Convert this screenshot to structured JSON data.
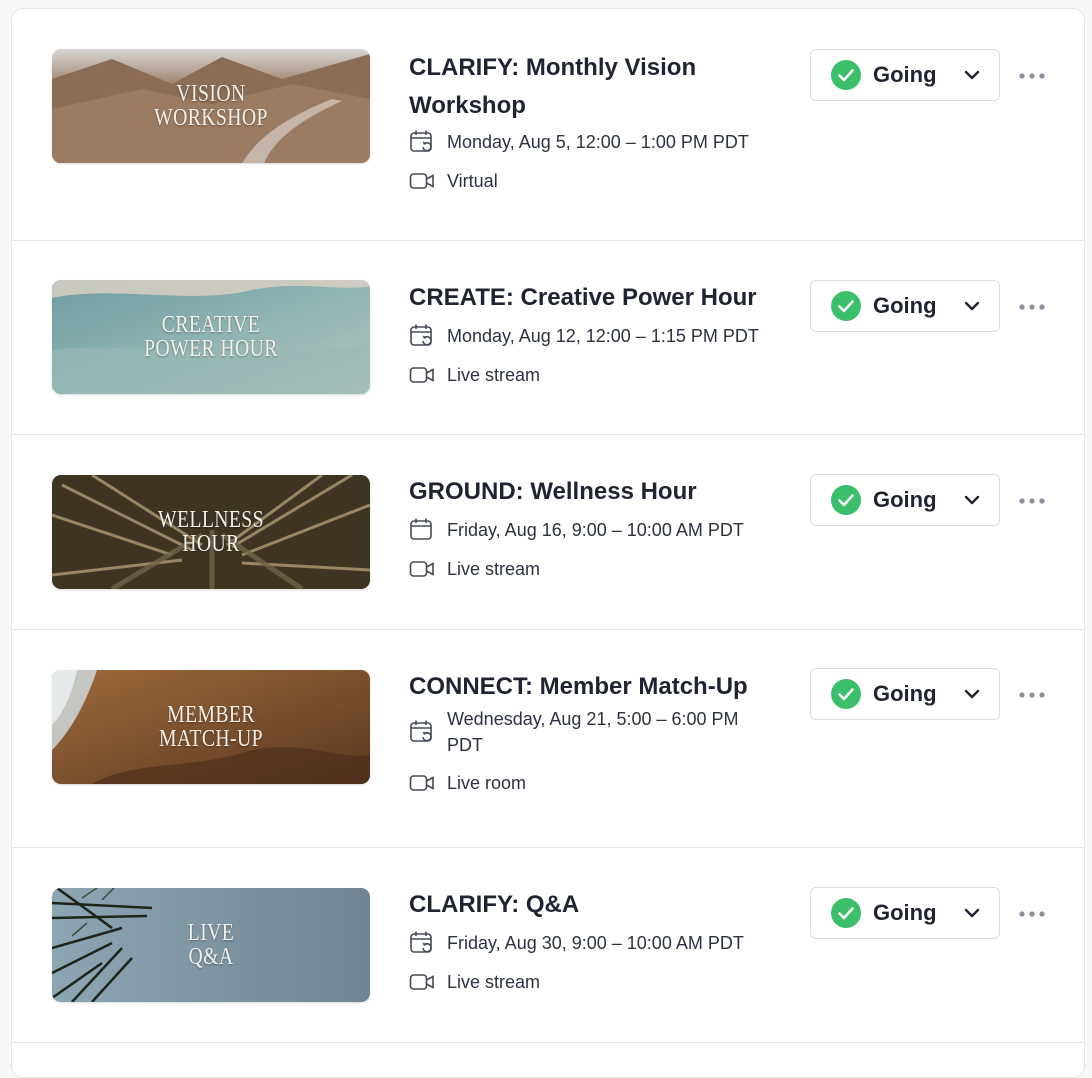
{
  "events": [
    {
      "title": "CLARIFY: Monthly Vision Workshop",
      "thumb_text": "VISION\nWORKSHOP",
      "thumb_theme": "desert",
      "date": "Monday, Aug 5, 12:00 – 1:00 PM PDT",
      "date_icon": "calendar-repeat-icon",
      "location": "Virtual",
      "rsvp": "Going"
    },
    {
      "title": "CREATE: Creative Power Hour",
      "thumb_text": "CREATIVE\nPOWER HOUR",
      "thumb_theme": "water",
      "date": "Monday, Aug 12, 12:00 – 1:15 PM PDT",
      "date_icon": "calendar-repeat-icon",
      "location": "Live stream",
      "rsvp": "Going"
    },
    {
      "title": "GROUND: Wellness Hour",
      "thumb_text": "WELLNESS\nHOUR",
      "thumb_theme": "palm",
      "date": "Friday, Aug 16, 9:00 – 10:00 AM PDT",
      "date_icon": "calendar-icon",
      "location": "Live stream",
      "rsvp": "Going"
    },
    {
      "title": "CONNECT: Member Match-Up",
      "thumb_text": "MEMBER\nMATCH-UP",
      "thumb_theme": "rock",
      "date": "Wednesday, Aug 21, 5:00 – 6:00 PM PDT",
      "date_icon": "calendar-repeat-icon",
      "location": "Live room",
      "rsvp": "Going"
    },
    {
      "title": "CLARIFY: Q&A",
      "thumb_text": "LIVE\nQ&A",
      "thumb_theme": "sky",
      "date": "Friday, Aug 30, 9:00 – 10:00 AM PDT",
      "date_icon": "calendar-repeat-icon",
      "location": "Live stream",
      "rsvp": "Going"
    }
  ],
  "colors": {
    "going_green": "#3bbf6a",
    "text": "#1f2430",
    "border": "#e3e5e9"
  }
}
